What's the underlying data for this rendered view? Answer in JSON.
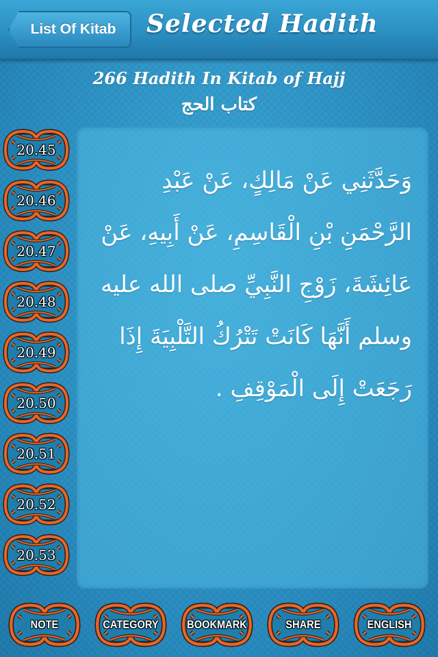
{
  "navbar": {
    "back_label": "List Of Kitab",
    "title": "Selected Hadith"
  },
  "header": {
    "subtitle": "266 Hadith In Kitab of Hajj",
    "arabic_title": "كتاب الحج"
  },
  "hadith_list": [
    "20.45",
    "20.46",
    "20.47",
    "20.48",
    "20.49",
    "20.50",
    "20.51",
    "20.52",
    "20.53"
  ],
  "hadith_text": "وَحَدَّثَنِي عَنْ مَالِكٍ، عَنْ عَبْدِ الرَّحْمَنِ بْنِ الْقَاسِمِ، عَنْ أَبِيهِ، عَنْ عَائِشَةَ، زَوْجِ النَّبِيِّ صلى الله عليه وسلم أَنَّهَا كَانَتْ تَتْرُكُ التَّلْبِيَةَ إِذَا رَجَعَتْ إِلَى الْمَوْقِفِ .",
  "toolbar": [
    "NOTE",
    "CATEGORY",
    "BOOKMARK",
    "SHARE",
    "ENGLISH"
  ],
  "colors": {
    "background": "#2a90c2",
    "knot_orange": "#e3672e",
    "knot_teal": "#1e7fae",
    "panel": "#5ab9e1"
  },
  "icons": {
    "back": "back-arrow-button",
    "list_badge": "celtic-knot-frame",
    "toolbar_badge": "celtic-knot-frame"
  }
}
